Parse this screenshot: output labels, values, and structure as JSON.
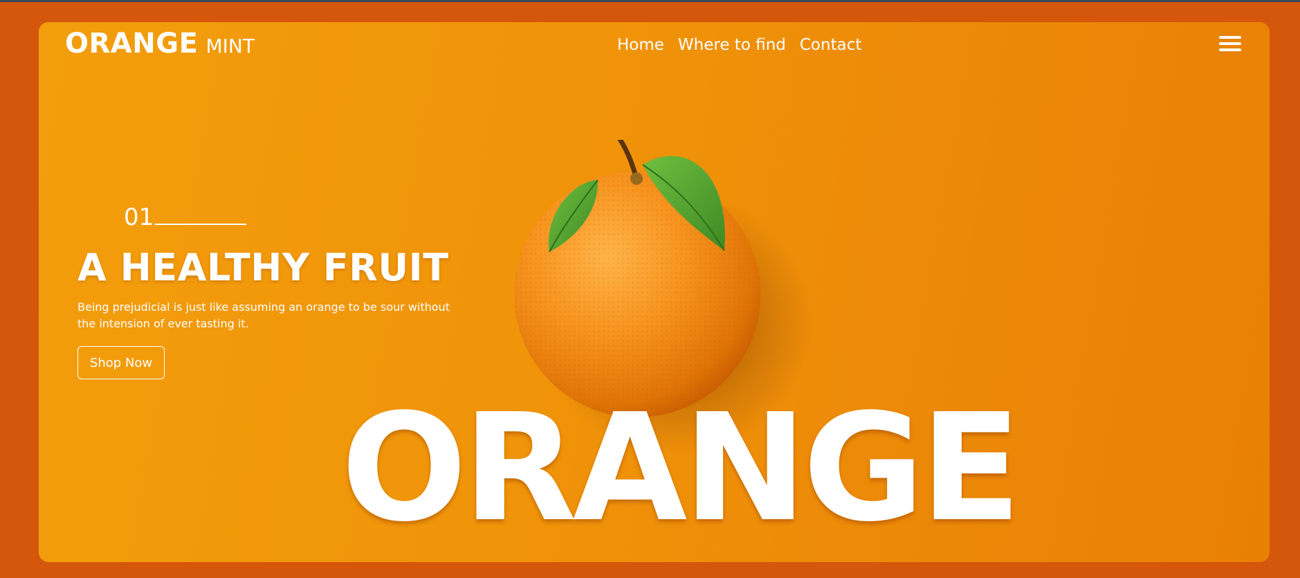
{
  "brand": {
    "name": "ORANGE",
    "sub": "MINT"
  },
  "nav": {
    "items": [
      "Home",
      "Where to find",
      "Contact"
    ]
  },
  "hero": {
    "counter": "01",
    "headline": "A HEALTHY FRUIT",
    "description": "Being prejudicial is just like assuming an orange to be sour without the intension of ever tasting it.",
    "cta_label": "Shop Now",
    "big_word": "ORANGE"
  },
  "icons": {
    "menu": "hamburger-menu-icon"
  },
  "colors": {
    "background": "#d4570b",
    "card_start": "#f39e0c",
    "card_end": "#e98006",
    "text": "#ffffff",
    "leaf": "#4e9a2e"
  }
}
